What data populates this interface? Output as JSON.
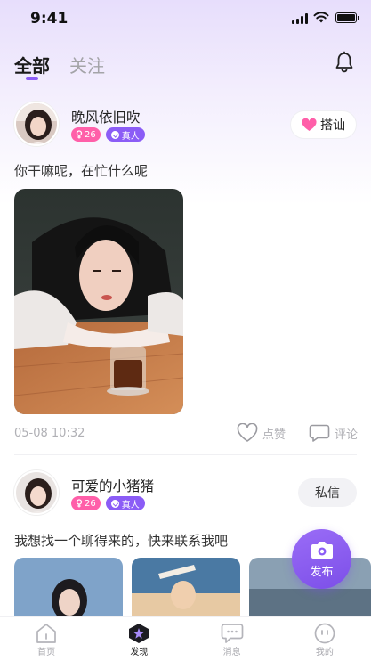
{
  "status": {
    "time": "9:41"
  },
  "tabs": [
    {
      "label": "全部",
      "active": true
    },
    {
      "label": "关注",
      "active": false
    }
  ],
  "icons": {
    "notifications": "bell-icon",
    "like": "heart-icon",
    "comment": "comment-icon",
    "publish": "camera-icon"
  },
  "posts": [
    {
      "username": "晚风依旧吹",
      "age_badge": "26",
      "verified_badge": "真人",
      "action_label": "搭讪",
      "text": "你干嘛呢，在忙什么呢",
      "time": "05-08 10:32",
      "like_label": "点赞",
      "comment_label": "评论"
    },
    {
      "username": "可爱的小猪猪",
      "age_badge": "26",
      "verified_badge": "真人",
      "action_label": "私信",
      "text": "我想找一个聊得来的，快来联系我吧"
    }
  ],
  "fab": {
    "label": "发布"
  },
  "tabbar": [
    {
      "label": "首页",
      "icon": "home-icon",
      "active": false
    },
    {
      "label": "发现",
      "icon": "discover-icon",
      "active": true
    },
    {
      "label": "消息",
      "icon": "message-icon",
      "active": false
    },
    {
      "label": "我的",
      "icon": "profile-icon",
      "active": false
    }
  ],
  "colors": {
    "accent": "#8b5cf6",
    "pink": "#ff5fa9"
  }
}
